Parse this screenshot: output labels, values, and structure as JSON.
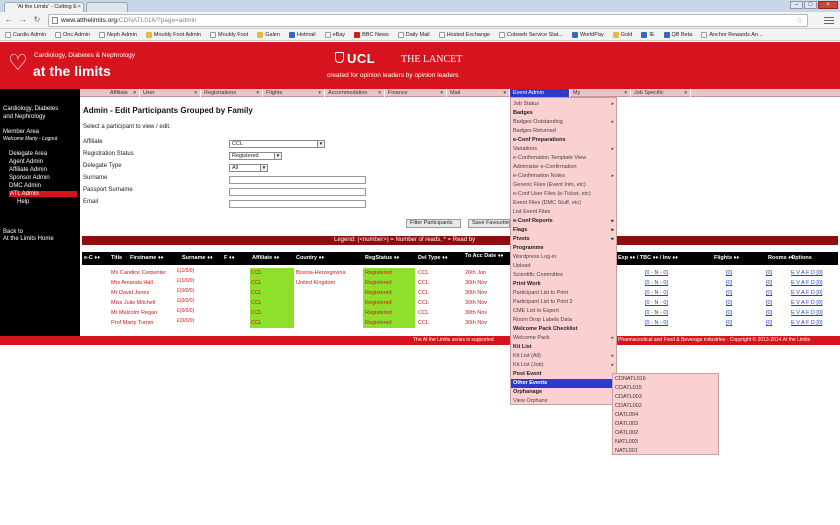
{
  "browser": {
    "tab_title": "'At the Limits' - Cutting E",
    "tab2_title": "",
    "url_prefix": "www.atthelimits.org",
    "url_path": "/CDNATL016/?page=admin",
    "bookmarks": [
      "Cardio Admin",
      "Onc Admin",
      "Neph Admin",
      "Mouldy Foot Admin",
      "Mouldy Foot",
      "Galen",
      "Hotmail",
      "eBay",
      "BBC News",
      "Daily Mail",
      "Hosted Exchange",
      "Cobweb Service Stat...",
      "WorldPay",
      "Gold",
      "IE",
      "QB Beta",
      "Anchor Rewards An..."
    ]
  },
  "site": {
    "logo_small": "Cardiology, Diabetes & Nephrology",
    "logo_big": "at the limits",
    "ucl": "UCL",
    "lancet": "THE LANCET",
    "tagline": "created for opinion leaders by opinion leaders"
  },
  "nav": [
    "Affiliate",
    "User",
    "Registrations",
    "Flights",
    "Accommodation",
    "Finance",
    "Mail",
    "Event Admin",
    "My",
    "Job Specific"
  ],
  "sidebar": {
    "event_title_1": "Cardiology, Diabetes",
    "event_title_2": "and Nephrology",
    "member_area": "Member Area",
    "welcome": "Welcome Marty - Logout",
    "items": [
      "Delegate Area",
      "Agent Admin",
      "Affiliate Admin",
      "Sponsor Admin",
      "DMC Admin",
      "ATL Admin",
      "Help"
    ],
    "back_1": "Back to",
    "back_2": "At the Limits Home"
  },
  "page": {
    "title": "Admin - Edit Participants Grouped by Family",
    "subtitle": "Select a participant to view / edit.",
    "fields": {
      "affiliate_label": "Affiliate",
      "affiliate_value": "CCL",
      "status_label": "Registration Status",
      "status_value": "Registered",
      "type_label": "Delegate Type",
      "type_value": "All",
      "surname_label": "Surname",
      "passport_label": "Passport Surname",
      "email_label": "Email"
    },
    "filter_button": "Filter Participants",
    "save_button": "Save Favourite",
    "legend": "Legend: (<number>) = Number of reads, * = Read by"
  },
  "table": {
    "headers": [
      "e-C ♦♦",
      "Title",
      "Firstname ♦♦",
      "Surname ♦♦",
      "F ♦♦",
      "Affiliate ♦♦",
      "Country ♦♦",
      "RegStatus ♦♦",
      "Del Type ♦♦",
      "To Acc Date ♦♦",
      "Exp ♦♦ / TBC ♦♦ / Inv ♦♦",
      "Flights ♦♦",
      "Rooms ♦♦",
      "Options"
    ],
    "rows": [
      {
        "name": "Ms Candice Carpenter",
        "reads": "£(1/0/0)",
        "affiliate": "CCL",
        "country": "Bosnia-Herzegovina",
        "status": "Registered",
        "deltype": "CCL",
        "date": "26th Jun",
        "exp": "[0 - N - 0]",
        "flights": "[0]",
        "rooms": "[0]",
        "options": "E V A F D [0]"
      },
      {
        "name": "Mrs Amanda Hall",
        "reads": "£(1/0/0)",
        "affiliate": "CCL",
        "country": "United Kingdom",
        "status": "Registered",
        "deltype": "CCL",
        "date": "30th Nov",
        "exp": "[0 - N - 0]",
        "flights": "[0]",
        "rooms": "[0]",
        "options": "E V A F D [0]"
      },
      {
        "name": "Mr David Jones",
        "reads": "£(0/0/0)",
        "affiliate": "CCL",
        "country": "",
        "status": "Registered",
        "deltype": "CCL",
        "date": "30th Nov",
        "exp": "[0 - N - 0]",
        "flights": "[0]",
        "rooms": "[0]",
        "options": "E V A F D [0]"
      },
      {
        "name": "Miss Julie Mitchell",
        "reads": "£(0/0/0)",
        "affiliate": "CCL",
        "country": "",
        "status": "Registered",
        "deltype": "CCL",
        "date": "30th Nov",
        "exp": "[0 - N - 0]",
        "flights": "[0]",
        "rooms": "[0]",
        "options": "E V A F D [0]"
      },
      {
        "name": "Mr Malcolm Regan",
        "reads": "£(0/0/0)",
        "affiliate": "CCL",
        "country": "",
        "status": "Registered",
        "deltype": "CCL",
        "date": "30th Nov",
        "exp": "[0 - N - 0]",
        "flights": "[0]",
        "rooms": "[0]",
        "options": "E V A F D [0]"
      },
      {
        "name": "Prof Marty Turner",
        "reads": "£(0/0/0)",
        "affiliate": "CCL",
        "country": "",
        "status": "Registered",
        "deltype": "CCL",
        "date": "30th Nov",
        "exp": "[0 - N - 0]",
        "flights": "[0]",
        "rooms": "[0]",
        "options": "E V A F D [0]"
      }
    ]
  },
  "footer": {
    "left": "The At the Limits series is supported",
    "right": "Pharmaceutical and Food & Beverage industries - Copyright © 2013-2014 At the Limits"
  },
  "menu": {
    "items": [
      {
        "label": "Job Status",
        "style": "normal",
        "sub": true
      },
      {
        "label": "Badges",
        "style": "bold",
        "sub": false
      },
      {
        "label": "Badges Outstanding",
        "style": "normal",
        "sub": true
      },
      {
        "label": "Badges Returned",
        "style": "normal",
        "sub": false
      },
      {
        "label": "e-Conf Preparations",
        "style": "bold",
        "sub": false
      },
      {
        "label": "Variations",
        "style": "normal",
        "sub": true
      },
      {
        "label": "e-Confirmation Template View",
        "style": "normal",
        "sub": false
      },
      {
        "label": "Administer e-Confirmation",
        "style": "normal",
        "sub": false
      },
      {
        "label": "e-Confirmation Notes",
        "style": "normal",
        "sub": true
      },
      {
        "label": "Generic Files (Event Info, etc)",
        "style": "normal",
        "sub": false
      },
      {
        "label": "e-Conf User Files (e-Ticket, etc)",
        "style": "normal",
        "sub": false
      },
      {
        "label": "Event Files (DMC Stuff, etc)",
        "style": "normal",
        "sub": false
      },
      {
        "label": "List Event Files",
        "style": "normal",
        "sub": false
      },
      {
        "label": "e-Conf Reports",
        "style": "bold",
        "sub": true
      },
      {
        "label": "Flags",
        "style": "bold",
        "sub": true
      },
      {
        "label": "Pivots",
        "style": "bold",
        "sub": true
      },
      {
        "label": "Programme",
        "style": "bold",
        "sub": false
      },
      {
        "label": "Wordpress Log-in",
        "style": "normal",
        "sub": false
      },
      {
        "label": "Upload",
        "style": "normal",
        "sub": false
      },
      {
        "label": "Scientific Committee",
        "style": "normal",
        "sub": false
      },
      {
        "label": "Print Work",
        "style": "bold",
        "sub": false
      },
      {
        "label": "Participant List to Print",
        "style": "normal",
        "sub": false
      },
      {
        "label": "Participant List to Print 2",
        "style": "normal",
        "sub": false
      },
      {
        "label": "CME List to Export",
        "style": "normal",
        "sub": false
      },
      {
        "label": "Room Drop Labels Data",
        "style": "normal",
        "sub": false
      },
      {
        "label": "Welcome Pack Checklist",
        "style": "bold",
        "sub": false
      },
      {
        "label": "Welcome Pack",
        "style": "normal",
        "sub": true
      },
      {
        "label": "Kit List",
        "style": "bold",
        "sub": false
      },
      {
        "label": "Kit List (All)",
        "style": "normal",
        "sub": true
      },
      {
        "label": "Kit List (Job)",
        "style": "normal",
        "sub": true
      },
      {
        "label": "Post Event",
        "style": "bold",
        "sub": false
      },
      {
        "label": "Other Events",
        "style": "sel",
        "sub": true
      },
      {
        "label": "Orphanage",
        "style": "bold",
        "sub": false
      },
      {
        "label": "View Orphans",
        "style": "normal",
        "sub": false
      }
    ],
    "submenu": [
      "CDNATL016",
      "CDATL015",
      "CDATL003",
      "CDATL002",
      "OATL004",
      "OATL003",
      "OATL002",
      "NATL003",
      "NATL001"
    ]
  }
}
